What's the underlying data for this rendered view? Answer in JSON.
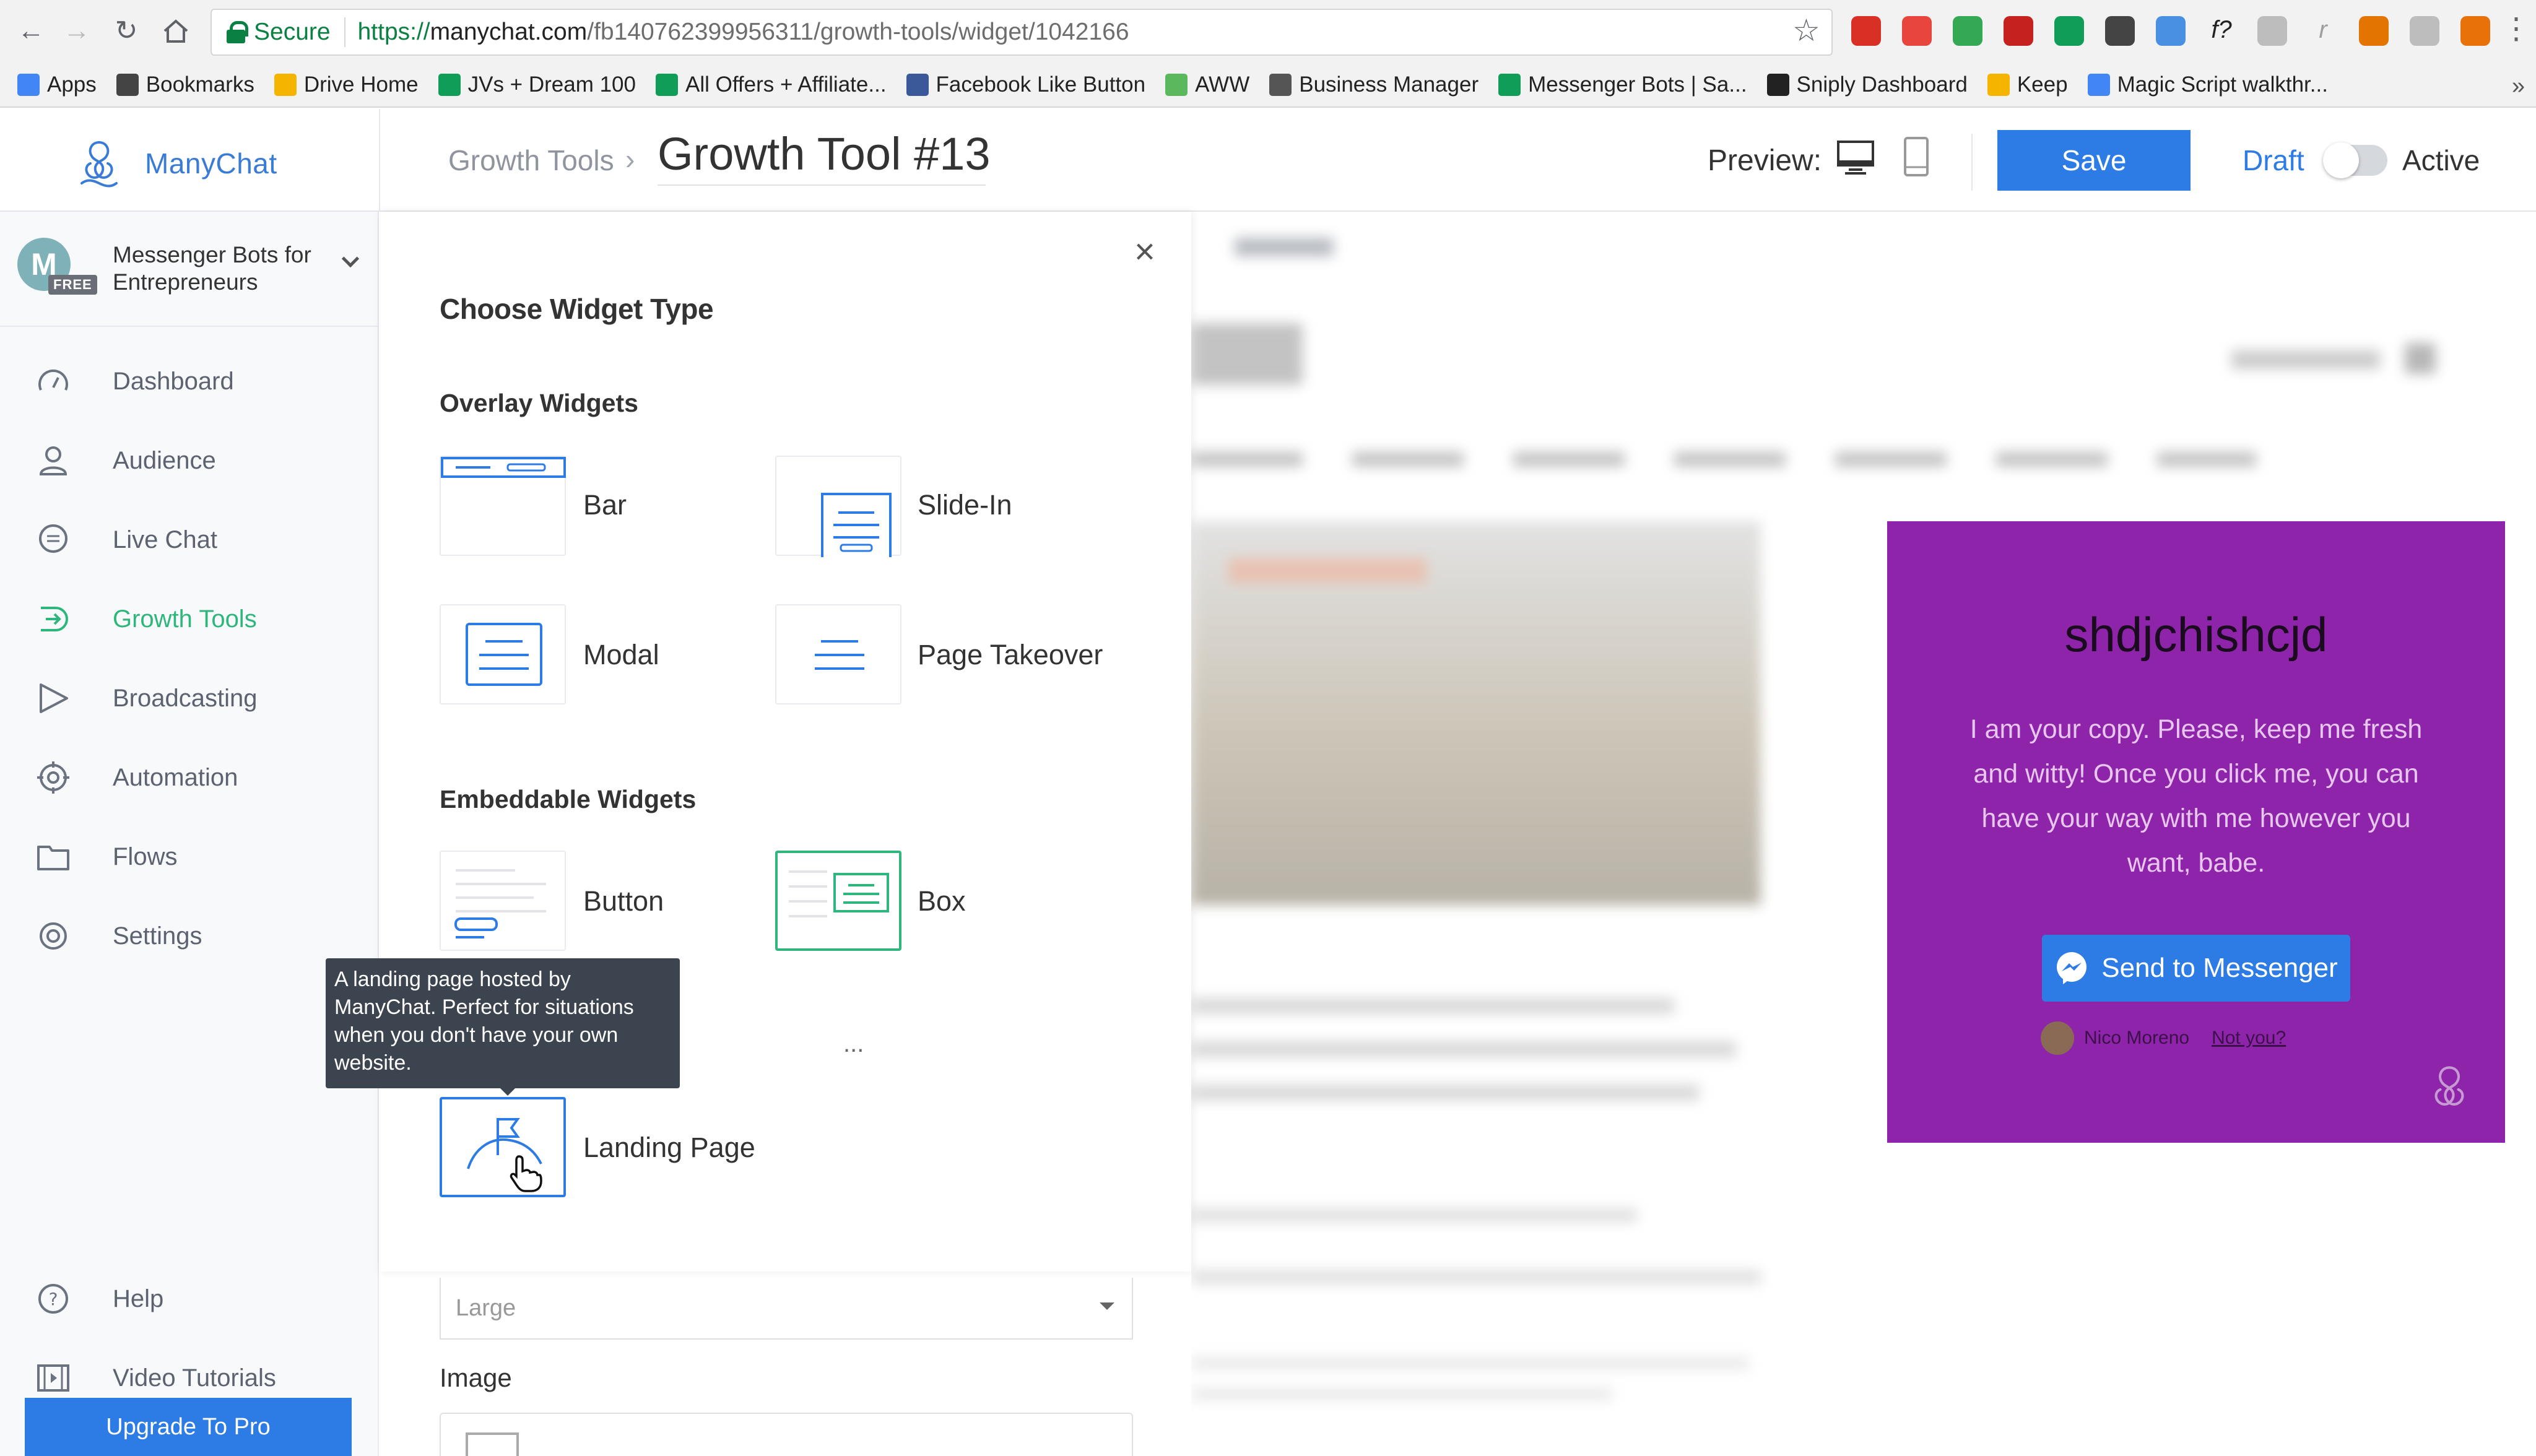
{
  "browser": {
    "secure_label": "Secure",
    "url_proto": "https://",
    "url_domain": "manychat.com",
    "url_path": "/fb140762399956311/growth-tools/widget/1042166",
    "bookmarks": [
      {
        "label": "Apps",
        "icon": "apps-grid-icon",
        "color": "#4285f4"
      },
      {
        "label": "Bookmarks",
        "icon": "star-icon",
        "color": "#444444"
      },
      {
        "label": "Drive Home",
        "icon": "drive-icon",
        "color": "#f4b400"
      },
      {
        "label": "JVs + Dream 100",
        "icon": "sheets-icon",
        "color": "#0f9d58"
      },
      {
        "label": "All Offers + Affiliate...",
        "icon": "sheets-icon",
        "color": "#0f9d58"
      },
      {
        "label": "Facebook Like Button",
        "icon": "facebook-icon",
        "color": "#3b5998"
      },
      {
        "label": "AWW",
        "icon": "aww-icon",
        "color": "#5cb85c"
      },
      {
        "label": "Business Manager",
        "icon": "page-icon",
        "color": "#555555"
      },
      {
        "label": "Messenger Bots | Sa...",
        "icon": "sheets-icon",
        "color": "#0f9d58"
      },
      {
        "label": "Sniply Dashboard",
        "icon": "sniply-icon",
        "color": "#222222"
      },
      {
        "label": "Keep",
        "icon": "keep-icon",
        "color": "#f4b400"
      },
      {
        "label": "Magic Script walkthr...",
        "icon": "docs-icon",
        "color": "#4285f4"
      }
    ],
    "extension_colors": [
      "#d93025",
      "#e8453c",
      "#34a853",
      "#c5221f",
      "#0f9d58",
      "#444444",
      "#4a90e2",
      "#222222",
      "#bdbdbd",
      "#9e9e9e",
      "#e37400",
      "#bdbdbd",
      "#e8710a"
    ],
    "extension_glyphs": [
      "",
      "",
      "",
      "",
      "",
      "",
      "",
      "f?",
      "",
      "r",
      "",
      "",
      ""
    ]
  },
  "header": {
    "logo_text": "ManyChat",
    "breadcrumb": "Growth Tools",
    "page_title": "Growth Tool #13",
    "preview_label": "Preview:",
    "save_label": "Save",
    "draft_label": "Draft",
    "active_label": "Active",
    "accent": "#2d7be5"
  },
  "sidebar": {
    "account_initial": "M",
    "account_badge": "FREE",
    "account_name": "Messenger Bots for Entrepreneurs",
    "items": [
      {
        "label": "Dashboard",
        "icon": "dashboard-gauge-icon",
        "active": false
      },
      {
        "label": "Audience",
        "icon": "person-icon",
        "active": false
      },
      {
        "label": "Live Chat",
        "icon": "chat-bubble-icon",
        "active": false
      },
      {
        "label": "Growth Tools",
        "icon": "growth-tools-icon",
        "active": true
      },
      {
        "label": "Broadcasting",
        "icon": "send-arrow-icon",
        "active": false
      },
      {
        "label": "Automation",
        "icon": "automation-gear-icon",
        "active": false
      },
      {
        "label": "Flows",
        "icon": "folder-icon",
        "active": false
      },
      {
        "label": "Settings",
        "icon": "settings-gear-icon",
        "active": false
      }
    ],
    "bottom_items": [
      {
        "label": "Help",
        "icon": "help-circle-icon"
      },
      {
        "label": "Video Tutorials",
        "icon": "video-film-icon"
      }
    ],
    "upgrade_label": "Upgrade To Pro",
    "active_color": "#2eb67d"
  },
  "modal": {
    "title": "Choose Widget Type",
    "overlay_title": "Overlay Widgets",
    "embeddable_title": "Embeddable Widgets",
    "overlay": [
      "Bar",
      "Slide-In",
      "Modal",
      "Page Takeover"
    ],
    "embeddable": [
      "Button",
      "Box"
    ],
    "landing": "Landing Page",
    "tooltip": "A landing page hosted by ManyChat. Perfect for situations when you don't have your own website.",
    "selected": "Box",
    "hovered": "Landing Page"
  },
  "settings_below": {
    "size_value": "Large",
    "image_label": "Image"
  },
  "widget_preview": {
    "title": "shdjchishcjd",
    "body": "I am your copy. Please, keep me fresh and witty! Once you click me, you can have your way with me however you want, babe.",
    "button": "Send to Messenger",
    "user_name": "Nico Moreno",
    "not_you": "Not you?",
    "bg_color": "#8e24aa"
  }
}
